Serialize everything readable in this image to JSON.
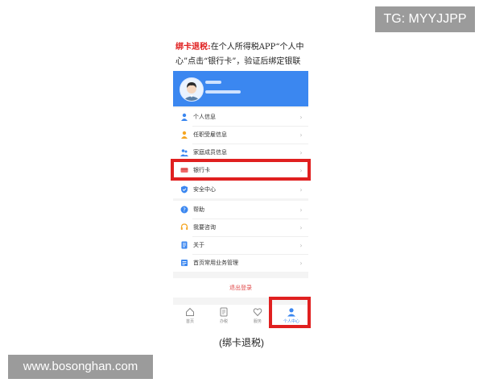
{
  "badges": {
    "top_right": "TG: MYYJJPP",
    "bottom_left": "www.bosonghan.com"
  },
  "instruction": {
    "highlight": "绑卡退税:",
    "text": "在个人所得税APP“个人中心”点击“银行卡”，验证后绑定银联卡。"
  },
  "menu": {
    "group1": [
      {
        "label": "个人信息",
        "icon": "person-icon"
      },
      {
        "label": "任职受雇信息",
        "icon": "employment-icon"
      },
      {
        "label": "家庭成员信息",
        "icon": "family-icon"
      }
    ],
    "bank_card": {
      "label": "银行卡",
      "icon": "bank-card-icon"
    },
    "security": {
      "label": "安全中心",
      "icon": "shield-icon"
    },
    "group2": [
      {
        "label": "帮助",
        "icon": "help-icon"
      },
      {
        "label": "我要咨询",
        "icon": "headset-icon"
      },
      {
        "label": "关于",
        "icon": "info-icon"
      },
      {
        "label": "首页常用业务管理",
        "icon": "manage-icon"
      }
    ]
  },
  "logout": "退出登录",
  "tabs": [
    {
      "label": "首页",
      "icon": "home-icon"
    },
    {
      "label": "办税",
      "icon": "tax-icon"
    },
    {
      "label": "服务",
      "icon": "service-icon"
    },
    {
      "label": "个人中心",
      "icon": "profile-icon",
      "active": true
    }
  ],
  "caption": "(绑卡退税)",
  "colors": {
    "accent": "#3b87f0",
    "highlight": "#e02020",
    "logout": "#e04a4a"
  }
}
